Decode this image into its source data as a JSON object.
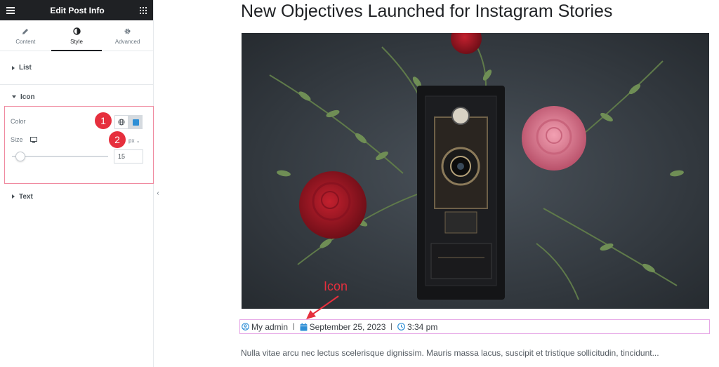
{
  "panel": {
    "title": "Edit Post Info",
    "tabs": [
      {
        "label": "Content",
        "icon": "pencil-icon"
      },
      {
        "label": "Style",
        "icon": "contrast-icon"
      },
      {
        "label": "Advanced",
        "icon": "gear-icon"
      }
    ],
    "active_tab": "Style",
    "sections": {
      "list": "List",
      "icon": "Icon",
      "text": "Text"
    },
    "color_label": "Color",
    "size_label": "Size",
    "size_unit": "px",
    "size_value": "15",
    "color_swatch": "#2e8fd6"
  },
  "markers": [
    "1",
    "2"
  ],
  "preview": {
    "title": "New Objectives Launched for Instagram Stories",
    "meta": {
      "author": "My admin",
      "date": "September 25, 2023",
      "time": "3:34 pm",
      "separator": "|"
    },
    "excerpt": "Nulla vitae arcu nec lectus scelerisque dignissim. Mauris massa lacus, suscipit et tristique sollicitudin, tincidunt...",
    "icon_color": "#2e8fd6"
  },
  "annotation": {
    "label": "Icon",
    "color": "#e62f3d"
  }
}
